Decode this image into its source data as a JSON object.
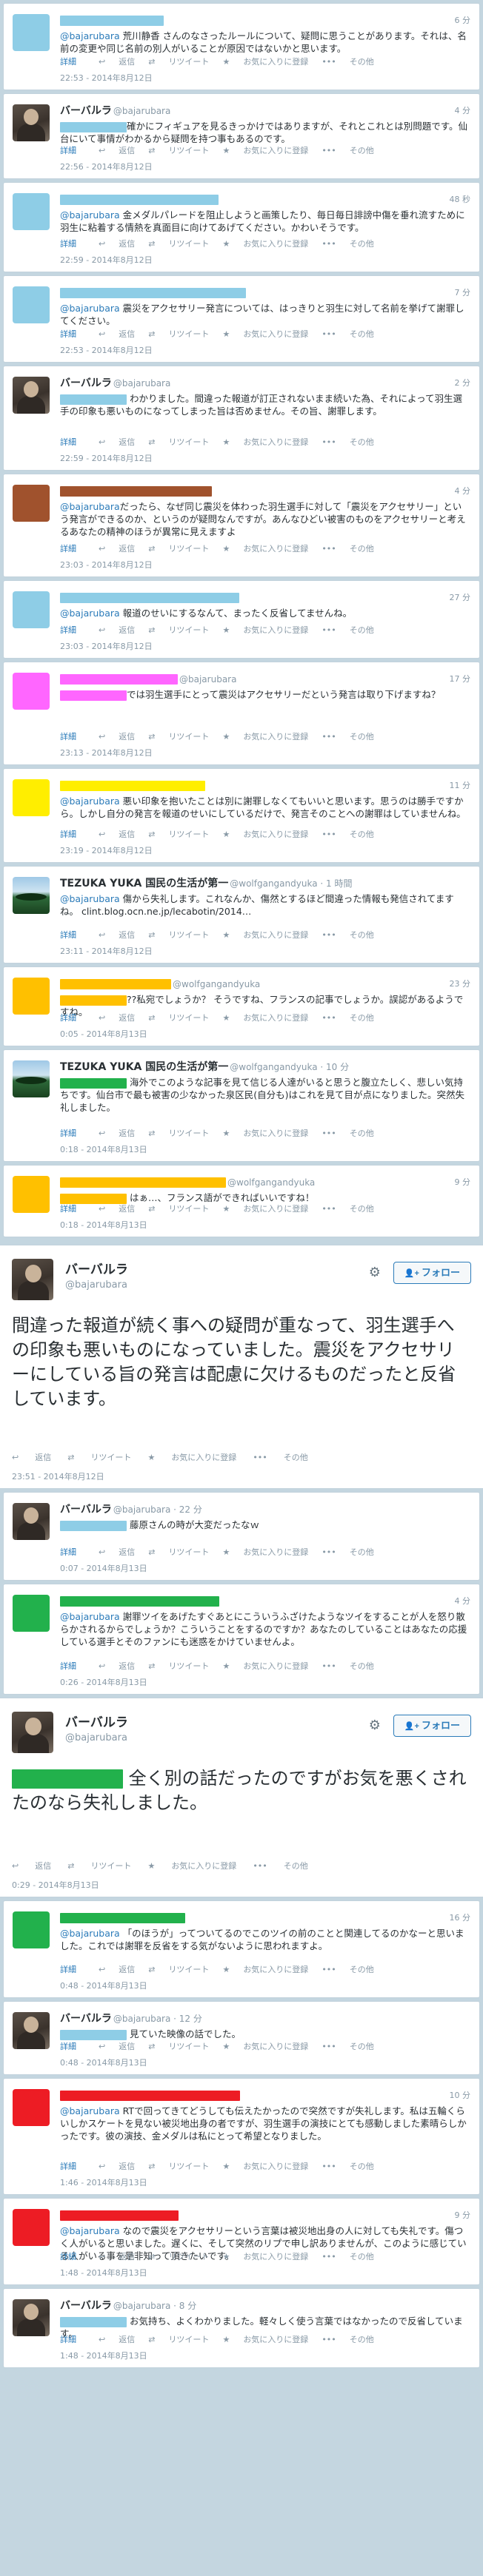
{
  "colors": {
    "page_bg": "#c4d6e0",
    "link": "#2b7bb9",
    "muted": "#8899a6",
    "redact_blue": "#8ecde6",
    "redact_brown": "#a0522d",
    "redact_magenta": "#ff66ff",
    "redact_yellow": "#ffee00",
    "redact_orange": "#ffc000",
    "redact_green": "#22b14c",
    "redact_red": "#ed1c24"
  },
  "actions": {
    "detail": "詳細",
    "reply": "返信",
    "retweet": "リツイート",
    "favorite": "お気に入りに登録",
    "more": "その他",
    "reply_icon": "reply-icon",
    "retweet_icon": "retweet-icon",
    "favorite_icon": "star-icon",
    "more_icon": "more-icon"
  },
  "follow_button": "フォロー",
  "tweets": [
    {
      "name": "",
      "screen": "",
      "time": "6 分",
      "redact": "blue",
      "text_parts": [
        "@bajarubara",
        " 荒川静香 さんのなさったルールについて、疑問に思うことがあります。それは、名前の変更や同じ名前の別人がいることが原因ではないかと思います。"
      ],
      "stamp": "22:53 - 2014年8月12日"
    },
    {
      "name": "バーバルラ",
      "screen": "@bajarubara",
      "time": "4 分",
      "avatar": "photo",
      "text_parts": [
        "",
        "確かにフィギュアを見るきっかけではありますが、それとこれとは別問題です。仙台にいて事情がわかるから疑問を持つ事もあるのです。"
      ],
      "stamp": "22:56 - 2014年8月12日"
    },
    {
      "name": "",
      "screen": "",
      "time": "48 秒",
      "redact": "blue",
      "text_parts": [
        "@bajarubara",
        " 金メダルパレードを阻止しようと画策したり、毎日毎日誹謗中傷を垂れ流すために羽生に粘着する情熱を真面目に向けてあげてください。かわいそうです。"
      ],
      "stamp": "22:59 - 2014年8月12日"
    },
    {
      "name": "",
      "screen": "",
      "time": "7 分",
      "redact": "blue",
      "text_parts": [
        "@bajarubara",
        " 震災をアクセサリー発言については、はっきりと羽生に対して名前を挙げて謝罪してください。"
      ],
      "stamp": "22:53 - 2014年8月12日"
    },
    {
      "name": "バーバルラ",
      "screen": "@bajarubara",
      "time": "2 分",
      "avatar": "photo",
      "text_parts": [
        "",
        " わかりました。間違った報道が訂正されないまま続いた為、それによって羽生選手の印象も悪いものになってしまった旨は否めません。その旨、謝罪します。"
      ],
      "stamp": "22:59 - 2014年8月12日"
    },
    {
      "name": "",
      "screen": "",
      "time": "4 分",
      "redact": "brown",
      "text_parts": [
        "@bajarubara",
        "だったら、なぜ同じ震災を体わった羽生選手に対して「震災をアクセサリー」という発言ができるのか、というのが疑問なんですが。あんなひどい被害のものをアクセサリーと考えるあなたの精神のほうが異常に見えますよ"
      ],
      "stamp": "23:03 - 2014年8月12日"
    },
    {
      "name": "",
      "screen": "",
      "time": "27 分",
      "redact": "blue",
      "text_parts": [
        "@bajarubara",
        " 報道のせいにするなんて、まったく反省してませんね。"
      ],
      "stamp": "23:03 - 2014年8月12日"
    },
    {
      "name": "",
      "screen": "@bajarubara",
      "time": "17 分",
      "redact": "magenta",
      "text_parts": [
        "",
        "では羽生選手にとって震災はアクセサリーだという発言は取り下げますね？"
      ],
      "stamp": "23:13 - 2014年8月12日"
    },
    {
      "name": "",
      "screen": "",
      "time": "11 分",
      "redact": "yellow",
      "text_parts": [
        "@bajarubara",
        " 悪い印象を抱いたことは別に謝罪しなくてもいいと思います。思うのは勝手ですから。しかし自分の発言を報道のせいにしているだけで、発言そのことへの謝罪はしていませんね。"
      ],
      "stamp": "23:19 - 2014年8月12日"
    },
    {
      "name": "TEZUKA YUKA 国民の生活が第一",
      "screen": "@wolfgangandyuka · 1 時間",
      "time": "",
      "avatar": "nature",
      "text_parts": [
        "@bajarubara",
        " 傷から失礼します。これなんか、傷然とするほど間違った情報も発信されてますね。 clint.blog.ocn.ne.jp/lecabotin/2014…"
      ],
      "stamp": "23:11 - 2014年8月12日"
    },
    {
      "name": "",
      "screen": "@wolfgangandyuka",
      "time": "23 分",
      "redact": "orange",
      "text_parts": [
        "",
        "??私宛でしょうか？ そうですね、フランスの記事でしょうか。誤認があるようですね。"
      ],
      "stamp": "0:05 - 2014年8月13日"
    },
    {
      "name": "TEZUKA YUKA 国民の生活が第一",
      "screen": "@wolfgangandyuka · 10 分",
      "time": "",
      "avatar": "nature",
      "text_parts": [
        "",
        " 海外でこのような記事を見て信じる人達がいると思うと腹立たしく、悲しい気持ちです。仙台市で最も被害の少なかった泉区民(自分も)はこれを見て目が点になりました。突然失礼しました。"
      ],
      "stamp": "0:18 - 2014年8月13日"
    },
    {
      "name": "",
      "screen": "@wolfgangandyuka",
      "time": "9 分",
      "redact": "orange",
      "text_parts": [
        "",
        " はぁ…、フランス語ができればいいですね！"
      ],
      "stamp": "0:18 - 2014年8月13日"
    },
    {
      "detail": true,
      "name": "バーバルラ",
      "screen": "@bajarubara",
      "avatar": "photo",
      "text": "間違った報道が続く事への疑問が重なって、羽生選手への印象も悪いものになっていました。震災をアクセサリーにしている旨の発言は配慮に欠けるものだったと反省しています。",
      "stamp": "23:51 - 2014年8月12日"
    },
    {
      "name": "バーバルラ",
      "screen": "@bajarubara · 22 分",
      "time": "",
      "avatar": "photo",
      "text_parts": [
        "",
        " 藤原さんの時が大変だったなｗ"
      ],
      "stamp": "0:07 - 2014年8月13日"
    },
    {
      "name": "",
      "screen": "",
      "time": "4 分",
      "redact": "green",
      "text_parts": [
        "@bajarubara",
        " 謝罪ツイをあげたすぐあとにこういうふざけたようなツイをすることが人を怒り散らかされるからでしょうか？こういうことをするのですか？あなたのしていることはあなたの応援している選手とそのファンにも迷惑をかけていませんよ。"
      ],
      "stamp": "0:26 - 2014年8月13日"
    },
    {
      "detail": true,
      "name": "バーバルラ",
      "screen": "@bajarubara",
      "avatar": "photo",
      "redact_lead": "green",
      "text": " 全く別の話だったのですがお気を悪くされたのなら失礼しました。",
      "stamp": "0:29 - 2014年8月13日"
    },
    {
      "name": "",
      "screen": "",
      "time": "16 分",
      "redact": "green",
      "text_parts": [
        "@bajarubara",
        " 「のほうが」ってついてるのでこのツイの前のことと関連してるのかなーと思いました。これでは謝罪を反省をする気がないように思われますよ。"
      ],
      "stamp": "0:48 - 2014年8月13日"
    },
    {
      "name": "バーバルラ",
      "screen": "@bajarubara · 12 分",
      "time": "",
      "avatar": "photo",
      "text_parts": [
        "",
        " 見ていた映像の話でした。"
      ],
      "stamp": "0:48 - 2014年8月13日"
    },
    {
      "name": "",
      "screen": "",
      "time": "10 分",
      "redact": "red",
      "text_parts": [
        "@bajarubara",
        " RTで回ってきてどうしても伝えたかったので突然ですが失礼します。私は五輪くらいしかスケートを見ない被災地出身の者ですが、羽生選手の演技にとても感動しました素晴らしかったです。彼の演技、金メダルは私にとって希望となりました。"
      ],
      "stamp": "1:46 - 2014年8月13日"
    },
    {
      "name": "",
      "screen": "",
      "time": "9 分",
      "redact": "red",
      "text_parts": [
        "@bajarubara",
        " なので震災をアクセサリーという言葉は被災地出身の人に対しても失礼です。傷つく人がいると思いました。遅くに、そして突然のリプで申し訳ありませんが、このように感じている人がいる事を是非知って頂きたいです。"
      ],
      "stamp": "1:48 - 2014年8月13日"
    },
    {
      "name": "バーバルラ",
      "screen": "@bajarubara · 8 分",
      "time": "",
      "avatar": "photo",
      "text_parts": [
        "",
        " お気持ち、よくわかりました。軽々しく使う言葉ではなかったので反省しています。"
      ],
      "stamp": "1:48 - 2014年8月13日"
    }
  ]
}
